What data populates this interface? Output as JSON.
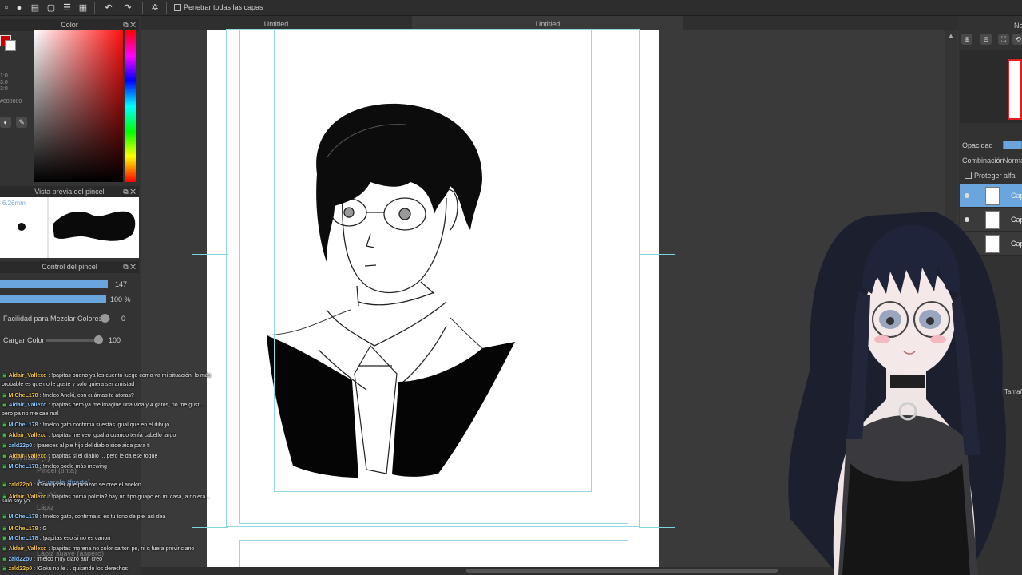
{
  "toolbar": {
    "penetrate_label": "Penetrar todas las capas"
  },
  "tabs": [
    {
      "label": "Untitled"
    },
    {
      "label": "Untitled"
    }
  ],
  "color_panel": {
    "title": "Color",
    "hex_value": "#000000",
    "fg_color": "#c80000",
    "bg_color": "#ffffff"
  },
  "brush_preview": {
    "title": "Vista previa del pincel",
    "size_text": "6.26mm"
  },
  "brush_control": {
    "title": "Control del pincel",
    "size_value": "147",
    "opacity_value": "100 %",
    "mix_label": "Facilidad para Mezclar Colores",
    "mix_value": "0",
    "load_label": "Cargar Color",
    "load_value": "100"
  },
  "chat": [
    {
      "user": "Aldair_Vallexd",
      "msg": " : !papitas bueno ya les cuento luego como va mi situación, lo más"
    },
    {
      "user": "",
      "msg": "probable es que no le guste y solo quiera ser amistad"
    },
    {
      "user": "MiCheL178",
      "msg": " : !melco Aneki, con cuántas te atoras?"
    },
    {
      "user": "Aldair_Vallexd",
      "msg": " : !papitas pero ya me imagine una vida y 4 gatos, no me gust..."
    },
    {
      "user": "",
      "msg": "pero pa no me cae mal"
    },
    {
      "user": "MiCheL178",
      "msg": " : !melco gato confirma si estás igual que en el dibujo"
    },
    {
      "user": "Aldair_Vallexd",
      "msg": " : !papitas me veo igual a cuando tenía cabello largo"
    },
    {
      "user": "zald22p0",
      "msg": " : !pareces al pie hijo del diablo side aida para ti"
    },
    {
      "user": "Aldair_Vallexd",
      "msg": " : !papitas si el diablo ... pero le da ese toqué"
    },
    {
      "user": "MiCheL178",
      "msg": " : !melco pocle más mewing"
    },
    {
      "user": "zald22p0",
      "msg": " : !Goku joder que picazón se cree el anekin"
    },
    {
      "user": "",
      "msg": "solo soy yo"
    },
    {
      "user": "Aldair_Vallexd",
      "msg": " : !papitas homa policía? hay un tipo guapo en mi casa, a no era..."
    },
    {
      "user": "MiCheL178",
      "msg": " : !melco gato, confirma si es tu tono de piel así dea"
    },
    {
      "user": "MiCheL178",
      "msg": " : G"
    },
    {
      "user": "MiCheL178",
      "msg": " : !papitas eso si no es canon"
    },
    {
      "user": "Aldair_Vallexd",
      "msg": " : !papitas morena no color carton pe, ni q fuera provinciano"
    },
    {
      "user": "zald22p0",
      "msg": " : !melco muy claro aun creo"
    },
    {
      "user": "zald22p0",
      "msg": " : !Goku no le ... quitando los derechos"
    }
  ],
  "brush_ghosts": [
    {
      "label": "Sin título (?)"
    },
    {
      "label": "Pincel (tinta)"
    },
    {
      "label": "Acuarela (fuerte)"
    },
    {
      "label": "Gruñón"
    },
    {
      "label": "Lápiz"
    },
    {
      "label": "Lápiz suave (áspero)"
    }
  ],
  "right_panel": {
    "nav_title": "Na",
    "opacity_label": "Opacidad",
    "blend_label": "Combinación",
    "blend_value": "Norma",
    "protect_alpha_label": "Proteger alfa",
    "size_label": "Tamañ",
    "layers": [
      {
        "name": "Cap",
        "selected": true
      },
      {
        "name": "Cap",
        "selected": false
      },
      {
        "name": "Cap",
        "selected": false
      }
    ]
  },
  "icons": [
    "undo-icon",
    "redo-icon",
    "chat-icon",
    "layers-icon",
    "zoom-in-icon",
    "zoom-out-icon",
    "eye-icon"
  ]
}
